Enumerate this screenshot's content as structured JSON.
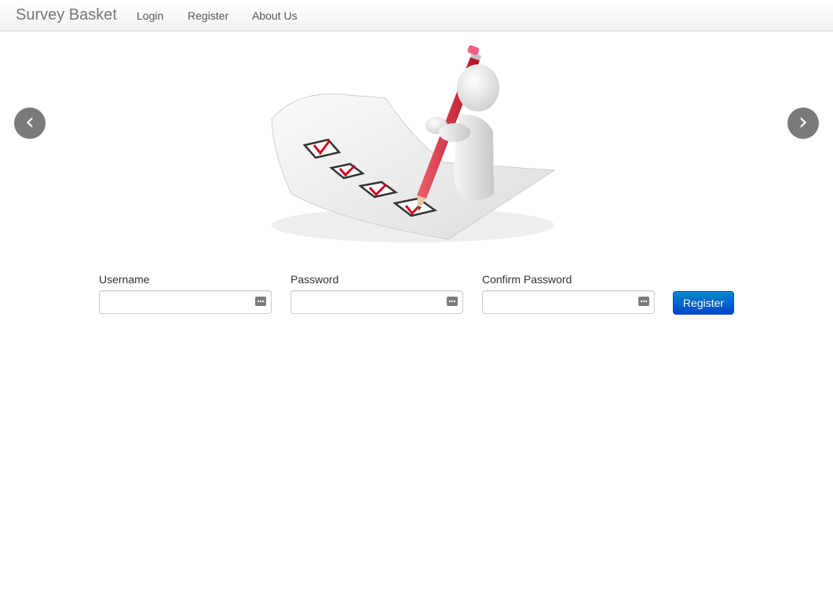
{
  "navbar": {
    "brand": "Survey Basket",
    "links": [
      "Login",
      "Register",
      "About Us"
    ]
  },
  "carousel": {
    "prev_label": "‹",
    "next_label": "›",
    "image": "survey-checklist-illustration"
  },
  "form": {
    "username_label": "Username",
    "username_value": "",
    "password_label": "Password",
    "password_value": "",
    "confirm_label": "Confirm Password",
    "confirm_value": "",
    "submit_label": "Register",
    "field_icon": "password-manager-key-icon"
  },
  "colors": {
    "primary": "#0074cc",
    "carousel_control": "#7a7a7a",
    "checkmark": "#d0021b"
  }
}
